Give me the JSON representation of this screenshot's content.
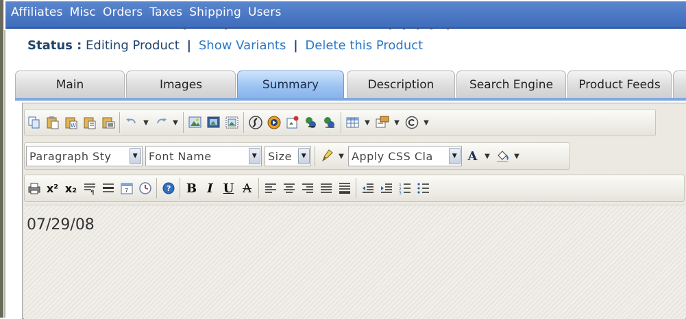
{
  "menu": {
    "items": [
      "Affiliates",
      "Misc",
      "Orders",
      "Taxes",
      "Shipping",
      "Users"
    ]
  },
  "status": {
    "label": "Status :",
    "value": "Editing Product",
    "separator": "|",
    "links": [
      "Show Variants",
      "Delete this Product"
    ]
  },
  "tabs": {
    "items": [
      "Main",
      "Images",
      "Summary",
      "Description",
      "Search Engine",
      "Product Feeds"
    ],
    "active": "Summary"
  },
  "toolbar": {
    "row2": {
      "paragraph_style": "Paragraph Sty",
      "font_name": "Font Name",
      "size": "Size",
      "css_class": "Apply CSS Cla",
      "font_color_glyph": "A"
    },
    "row3": {
      "superscript": "x²",
      "subscript": "x₂",
      "bold": "B",
      "italic": "I",
      "underline": "U",
      "strike": "A"
    }
  },
  "editor": {
    "content": "07/29/08"
  },
  "colors": {
    "menubar": "#4a78c4",
    "status_text": "#21456e",
    "link": "#2a78c8",
    "active_tab": "#9cc4f2"
  }
}
